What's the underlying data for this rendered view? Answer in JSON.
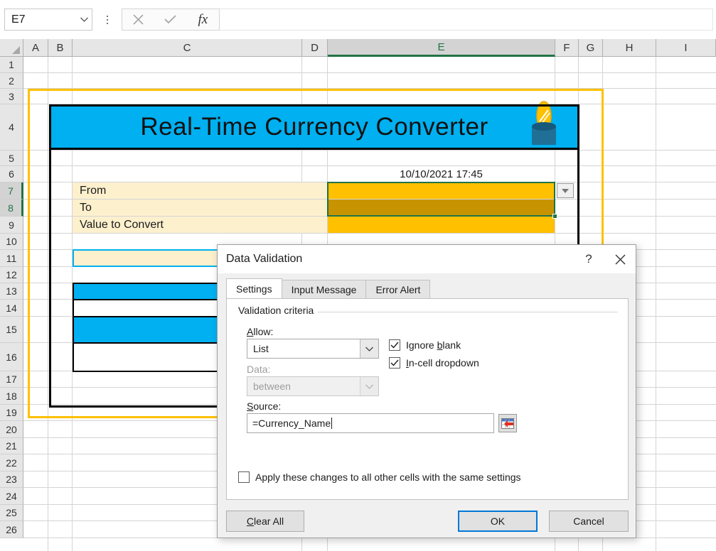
{
  "formula_bar": {
    "name_box_value": "E7",
    "cancel_icon": "close-icon",
    "enter_icon": "check-icon",
    "function_icon": "fx",
    "formula_value": ""
  },
  "grid": {
    "columns": [
      "A",
      "B",
      "C",
      "D",
      "E",
      "F",
      "G",
      "H",
      "I"
    ],
    "selected_column": "E",
    "rows": [
      "1",
      "2",
      "3",
      "4",
      "5",
      "6",
      "7",
      "8",
      "9",
      "10",
      "11",
      "12",
      "13",
      "14",
      "15",
      "16",
      "17",
      "18",
      "19",
      "20",
      "21",
      "22",
      "23",
      "24",
      "25",
      "26"
    ],
    "selected_rows": [
      "7",
      "8"
    ],
    "cells": {
      "banner_title": "Real-Time Currency Converter",
      "timestamp": "10/10/2021 17:45",
      "label_from": "From",
      "label_to": "To",
      "label_value_to_convert": "Value to Convert"
    },
    "colors": {
      "banner_fill": "#00b0f0",
      "input_fill": "#ffc000",
      "label_fill": "#fdf0cd",
      "selection_border": "#217346",
      "named_range_border": "#ffc000"
    }
  },
  "dialog": {
    "title": "Data Validation",
    "help_label": "?",
    "close_label": "✕",
    "tabs": [
      {
        "label": "Settings",
        "active": true
      },
      {
        "label": "Input Message",
        "active": false
      },
      {
        "label": "Error Alert",
        "active": false
      }
    ],
    "group_title": "Validation criteria",
    "allow_label": "Allow:",
    "allow_value": "List",
    "data_label": "Data:",
    "data_value": "between",
    "source_label": "Source:",
    "source_value": "=Currency_Name",
    "range_picker_icon": "range-select-icon",
    "checkbox_ignore_blank": "Ignore blank",
    "checkbox_in_cell_dropdown": "In-cell dropdown",
    "checkbox_apply_all": "Apply these changes to all other cells with the same settings",
    "buttons": {
      "clear_all": "Clear All",
      "ok": "OK",
      "cancel": "Cancel"
    },
    "accent": "#0078d7"
  }
}
